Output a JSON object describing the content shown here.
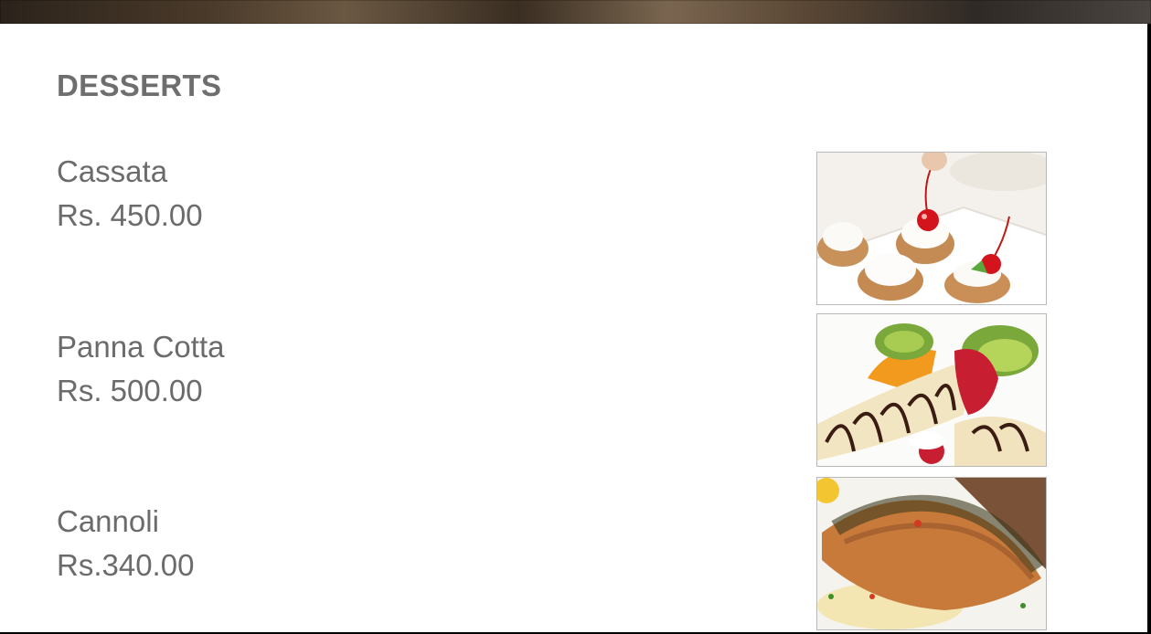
{
  "section": {
    "title": "DESSERTS"
  },
  "items": [
    {
      "name": "Cassata",
      "price": "Rs. 450.00",
      "image_icon": "cherry-tarts-photo"
    },
    {
      "name": "Panna Cotta",
      "price": "Rs. 500.00",
      "image_icon": "crepe-fruit-photo"
    },
    {
      "name": "Cannoli",
      "price": "Rs.340.00",
      "image_icon": "grilled-fish-photo"
    }
  ],
  "colors": {
    "text": "#6b6b6b",
    "title": "#6e6e6e",
    "panel": "#ffffff",
    "border": "#b8b8b8"
  }
}
